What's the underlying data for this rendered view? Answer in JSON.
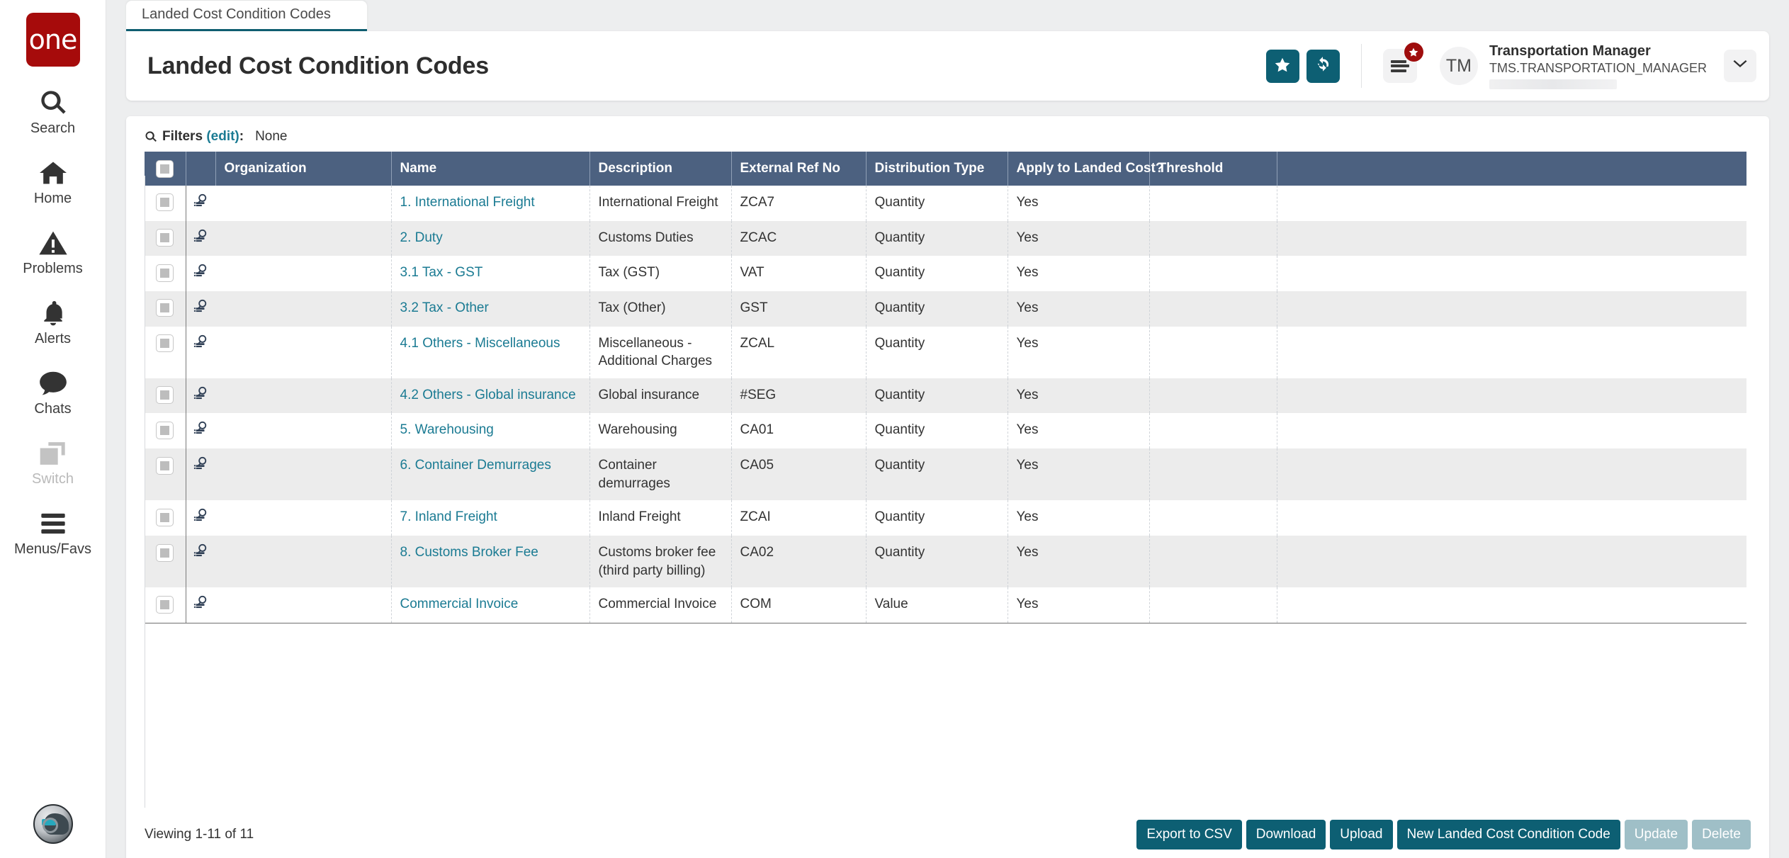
{
  "brand": {
    "logo_text": "one",
    "logo_color": "#a60b0b",
    "accent": "#0d5f73",
    "header_row_color": "#4c6180",
    "link_color": "#1b7b93"
  },
  "sidebar": {
    "items": [
      {
        "label": "Search",
        "icon": "search-icon",
        "disabled": false
      },
      {
        "label": "Home",
        "icon": "home-icon",
        "disabled": false
      },
      {
        "label": "Problems",
        "icon": "warning-triangle-icon",
        "disabled": false
      },
      {
        "label": "Alerts",
        "icon": "bell-icon",
        "disabled": false
      },
      {
        "label": "Chats",
        "icon": "chat-bubble-icon",
        "disabled": false
      },
      {
        "label": "Switch",
        "icon": "switch-windows-icon",
        "disabled": true
      },
      {
        "label": "Menus/Favs",
        "icon": "hamburger-icon",
        "disabled": false
      }
    ],
    "avatar": "user-avatar-image"
  },
  "tabs": [
    {
      "label": "Landed Cost Condition Codes",
      "active": true
    }
  ],
  "header": {
    "title": "Landed Cost Condition Codes",
    "favorite_icon": "star-icon",
    "refresh_icon": "refresh-icon",
    "menu_icon": "menu-list-icon",
    "menu_badge_icon": "star-badge-icon",
    "avatar_initials": "TM",
    "user_name": "Transportation Manager",
    "user_id": "TMS.TRANSPORTATION_MANAGER",
    "caret_icon": "chevron-down-icon"
  },
  "filters": {
    "icon": "search-icon",
    "label": "Filters",
    "edit_label": "(edit)",
    "colon": ":",
    "value": "None"
  },
  "table": {
    "columns": [
      "Organization",
      "Name",
      "Description",
      "External Ref No",
      "Distribution Type",
      "Apply to Landed Cost?",
      "Threshold"
    ],
    "row_icon": "view-details-icon",
    "select_all_icon": "checkbox-icon",
    "rows": [
      {
        "organization": "",
        "name": "1. International Freight",
        "description": "International Freight",
        "external_ref_no": "ZCA7",
        "distribution_type": "Quantity",
        "apply_to_landed_cost": "Yes",
        "threshold": ""
      },
      {
        "organization": "",
        "name": "2. Duty",
        "description": "Customs Duties",
        "external_ref_no": "ZCAC",
        "distribution_type": "Quantity",
        "apply_to_landed_cost": "Yes",
        "threshold": ""
      },
      {
        "organization": "",
        "name": "3.1 Tax - GST",
        "description": "Tax (GST)",
        "external_ref_no": "VAT",
        "distribution_type": "Quantity",
        "apply_to_landed_cost": "Yes",
        "threshold": ""
      },
      {
        "organization": "",
        "name": "3.2 Tax - Other",
        "description": "Tax (Other)",
        "external_ref_no": "GST",
        "distribution_type": "Quantity",
        "apply_to_landed_cost": "Yes",
        "threshold": ""
      },
      {
        "organization": "",
        "name": "4.1 Others - Miscellaneous",
        "description": "Miscellaneous - Additional Charges",
        "external_ref_no": "ZCAL",
        "distribution_type": "Quantity",
        "apply_to_landed_cost": "Yes",
        "threshold": ""
      },
      {
        "organization": "",
        "name": "4.2 Others - Global insurance",
        "description": "Global insurance",
        "external_ref_no": "#SEG",
        "distribution_type": "Quantity",
        "apply_to_landed_cost": "Yes",
        "threshold": ""
      },
      {
        "organization": "",
        "name": "5. Warehousing",
        "description": "Warehousing",
        "external_ref_no": "CA01",
        "distribution_type": "Quantity",
        "apply_to_landed_cost": "Yes",
        "threshold": ""
      },
      {
        "organization": "",
        "name": "6. Container Demurrages",
        "description": "Container demurrages",
        "external_ref_no": "CA05",
        "distribution_type": "Quantity",
        "apply_to_landed_cost": "Yes",
        "threshold": ""
      },
      {
        "organization": "",
        "name": "7. Inland Freight",
        "description": "Inland Freight",
        "external_ref_no": "ZCAI",
        "distribution_type": "Quantity",
        "apply_to_landed_cost": "Yes",
        "threshold": ""
      },
      {
        "organization": "",
        "name": "8. Customs Broker Fee",
        "description": "Customs broker fee (third party billing)",
        "external_ref_no": "CA02",
        "distribution_type": "Quantity",
        "apply_to_landed_cost": "Yes",
        "threshold": ""
      },
      {
        "organization": "",
        "name": "Commercial Invoice",
        "description": "Commercial Invoice",
        "external_ref_no": "COM",
        "distribution_type": "Value",
        "apply_to_landed_cost": "Yes",
        "threshold": ""
      }
    ]
  },
  "footer": {
    "viewing": "Viewing 1-11 of 11",
    "buttons": [
      {
        "label": "Export to CSV",
        "disabled": false
      },
      {
        "label": "Download",
        "disabled": false
      },
      {
        "label": "Upload",
        "disabled": false
      },
      {
        "label": "New Landed Cost Condition Code",
        "disabled": false
      },
      {
        "label": "Update",
        "disabled": true
      },
      {
        "label": "Delete",
        "disabled": true
      }
    ]
  }
}
